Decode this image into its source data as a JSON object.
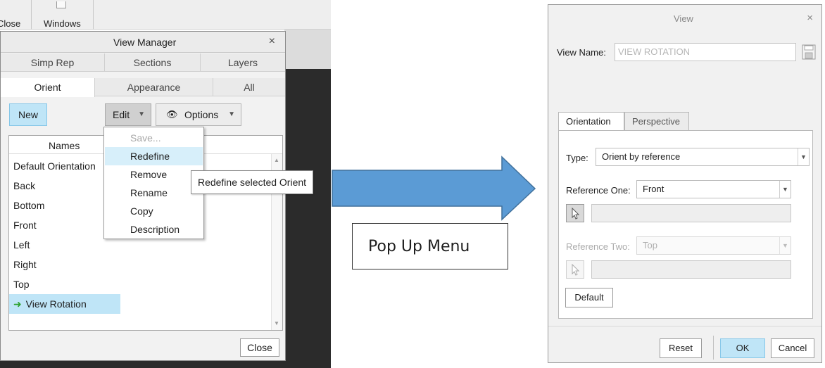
{
  "background_toolbar": {
    "close_label": "Close",
    "windows_label": "Windows"
  },
  "view_manager": {
    "title": "View Manager",
    "close_x": "×",
    "tabs_row1": [
      "Simp Rep",
      "Sections",
      "Layers"
    ],
    "tabs_row2": [
      "Orient",
      "Appearance",
      "All"
    ],
    "active_tab": "Orient",
    "new_label": "New",
    "edit_label": "Edit",
    "options_label": "Options",
    "list_header": "Names",
    "items": [
      "Default Orientation",
      "Back",
      "Bottom",
      "Front",
      "Left",
      "Right",
      "Top",
      "View Rotation"
    ],
    "selected_item": "View Rotation",
    "close_label": "Close"
  },
  "edit_menu": {
    "items": [
      {
        "label": "Save...",
        "disabled": true
      },
      {
        "label": "Redefine",
        "highlighted": true
      },
      {
        "label": "Remove"
      },
      {
        "label": "Rename"
      },
      {
        "label": "Copy"
      },
      {
        "label": "Description"
      }
    ],
    "tooltip": "Redefine selected Orient"
  },
  "callout": {
    "text": "Pop Up Menu"
  },
  "view_dialog": {
    "title": "View",
    "close_x": "×",
    "name_label": "View Name:",
    "name_value": "VIEW ROTATION",
    "tabs": [
      "Orientation",
      "Perspective"
    ],
    "type_label": "Type:",
    "type_value": "Orient by reference",
    "ref1_label": "Reference One:",
    "ref1_value": "Front",
    "ref2_label": "Reference Two:",
    "ref2_value": "Top",
    "default_label": "Default",
    "reset_label": "Reset",
    "ok_label": "OK",
    "cancel_label": "Cancel"
  },
  "colors": {
    "selection_blue": "#bfe5f7",
    "arrow_fill": "#5b9bd5",
    "arrow_stroke": "#41719c",
    "list_arrow_green": "#2aa02a"
  },
  "icons": {
    "options": "eye-icon",
    "save_name": "floppy-disk-icon",
    "pick": "cursor-arrow-icon",
    "dropdown": "chevron-down-icon"
  }
}
